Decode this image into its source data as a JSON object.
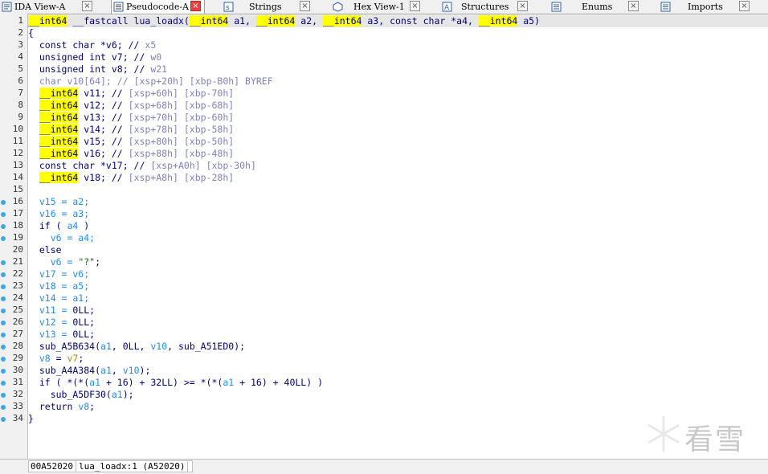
{
  "tabs": [
    {
      "label": "IDA View-A",
      "active": false
    },
    {
      "label": "Pseudocode-A",
      "active": true
    },
    {
      "label": "Strings",
      "active": false
    },
    {
      "label": "Hex View-1",
      "active": false
    },
    {
      "label": "Structures",
      "active": false
    },
    {
      "label": "Enums",
      "active": false
    },
    {
      "label": "Imports",
      "active": false
    }
  ],
  "close_glyph": "×",
  "line_numbers": [
    "1",
    "2",
    "3",
    "4",
    "5",
    "6",
    "7",
    "8",
    "9",
    "10",
    "11",
    "12",
    "13",
    "14",
    "15",
    "16",
    "17",
    "18",
    "19",
    "20",
    "21",
    "22",
    "23",
    "24",
    "25",
    "26",
    "27",
    "28",
    "29",
    "30",
    "31",
    "32",
    "33",
    "34"
  ],
  "breakpoint_lines": [
    "16",
    "17",
    "18",
    "19",
    "21",
    "22",
    "23",
    "24",
    "25",
    "26",
    "27",
    "28",
    "29",
    "30",
    "31",
    "32",
    "33",
    "34"
  ],
  "code": {
    "l1": {
      "t1": "__int64",
      "t2": " __fastcall lua_loadx(",
      "t3": "__int64",
      "t4": " a1, ",
      "t5": "__int64",
      "t6": " a2, ",
      "t7": "__int64",
      "t8": " a3, const char *a4, ",
      "t9": "__int64",
      "t10": " a5)"
    },
    "l2": "{",
    "l3": {
      "decl": "  const char *v6; // ",
      "cm": "x5"
    },
    "l4": {
      "decl": "  unsigned int v7; // ",
      "cm": "w0"
    },
    "l5": {
      "decl": "  unsigned int v8; // ",
      "cm": "w21"
    },
    "l6": {
      "decl": "  char v10[64]; // ",
      "cm": "[xsp+20h] [xbp-B0h] BYREF"
    },
    "l7": {
      "type": "__int64",
      "decl": " v11; // ",
      "cm": "[xsp+60h] [xbp-70h]"
    },
    "l8": {
      "type": "__int64",
      "decl": " v12; // ",
      "cm": "[xsp+68h] [xbp-68h]"
    },
    "l9": {
      "type": "__int64",
      "decl": " v13; // ",
      "cm": "[xsp+70h] [xbp-60h]"
    },
    "l10": {
      "type": "__int64",
      "decl": " v14; // ",
      "cm": "[xsp+78h] [xbp-58h]"
    },
    "l11": {
      "type": "__int64",
      "decl": " v15; // ",
      "cm": "[xsp+80h] [xbp-50h]"
    },
    "l12": {
      "type": "__int64",
      "decl": " v16; // ",
      "cm": "[xsp+88h] [xbp-48h]"
    },
    "l13": {
      "decl": "  const char *v17; // ",
      "cm": "[xsp+A0h] [xbp-30h]"
    },
    "l14": {
      "type": "__int64",
      "decl": " v18; // ",
      "cm": "[xsp+A8h] [xbp-28h]"
    },
    "l16": "  v15 = a2;",
    "l17": "  v16 = a3;",
    "l18": {
      "a": "  if ( ",
      "b": "a4",
      "c": " )"
    },
    "l19": "    v6 = a4;",
    "l20": "  else",
    "l21": {
      "a": "    v6 = ",
      "s": "\"?\"",
      "c": ";"
    },
    "l22": "  v17 = v6;",
    "l23": "  v18 = a5;",
    "l24": "  v14 = a1;",
    "l25": {
      "a": "  v11 = ",
      "n": "0LL",
      "c": ";"
    },
    "l26": {
      "a": "  v12 = ",
      "n": "0LL",
      "c": ";"
    },
    "l27": {
      "a": "  v13 = ",
      "n": "0LL",
      "c": ";"
    },
    "l28": {
      "a": "  sub_A5B634(",
      "b": "a1",
      "c": ", 0LL, ",
      "d": "v10",
      "e": ", sub_A51ED0);"
    },
    "l29": {
      "a": "  ",
      "b": "v8",
      "c": " = ",
      "d": "v7",
      "e": ";"
    },
    "l30": {
      "a": "  sub_A4A384(",
      "b": "a1",
      "c": ", ",
      "d": "v10",
      "e": ");"
    },
    "l31": {
      "a": "  if ( *(*(",
      "b": "a1",
      "c": " + 16) + 32LL) >= *(*(",
      "d": "a1",
      "e": " + 16) + 40LL) )"
    },
    "l32": {
      "a": "    sub_A5DF30(",
      "b": "a1",
      "c": ");"
    },
    "l33": {
      "a": "  return ",
      "b": "v8",
      "c": ";"
    },
    "l34": "}"
  },
  "status": {
    "address": "00A52020",
    "location": "lua_loadx:1 (A52020)"
  },
  "watermark": "看雪",
  "colors": {
    "highlight": "#ffff00",
    "comment": "#8080c0",
    "variable": "#1e8cff",
    "code": "#000080",
    "string": "#008000",
    "breakpoint": "#3aa7e8",
    "active_close": "#e04343"
  }
}
